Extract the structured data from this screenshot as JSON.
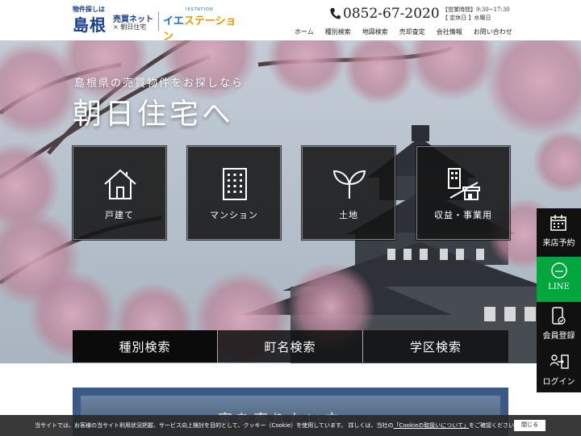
{
  "header": {
    "logo_tag": "物件探しは",
    "logo_main": "島根",
    "logo_sub": "売買ネット",
    "logo_partner": "×  朝日住宅",
    "logo_ie_top": "IESTATION",
    "logo_ie_a": "イエ",
    "logo_ie_b": "ステーション",
    "phone": "0852-67-2020",
    "hours_line1": "【営業時間】9:30~17:30",
    "hours_line2": "【 定休日 】水曜日",
    "nav": [
      "ホーム",
      "種別検索",
      "地図検索",
      "売却査定",
      "会社情報",
      "お問い合わせ"
    ]
  },
  "hero": {
    "tagline": "島根県の売買物件をお探しなら",
    "title": "朝日住宅へ",
    "categories": [
      {
        "label": "戸建て",
        "icon": "house-icon"
      },
      {
        "label": "マンション",
        "icon": "building-icon"
      },
      {
        "label": "土地",
        "icon": "sprout-icon"
      },
      {
        "label": "収益・事業用",
        "icon": "shop-icon"
      }
    ],
    "search_tabs": [
      "種別検索",
      "町名検索",
      "学区検索"
    ]
  },
  "side_menu": {
    "reserve": "来店予約",
    "line": "LINE",
    "register": "会員登録",
    "login": "ログイン"
  },
  "below": {
    "text": "家を売りたい方"
  },
  "cookie": {
    "text_before": "当サイトでは、お客様の当サイト利用状況把握、サービス向上検討を目的として、クッキー（Cookie）を使用しています。 詳しくは、当社の",
    "link": "「Cookieの取扱いについて」",
    "text_after": "をご確認ください。",
    "close": "閉じる"
  },
  "colors": {
    "brand_blue": "#1a3d8f",
    "line_green": "#00a73d",
    "accent_orange": "#e79a00"
  }
}
